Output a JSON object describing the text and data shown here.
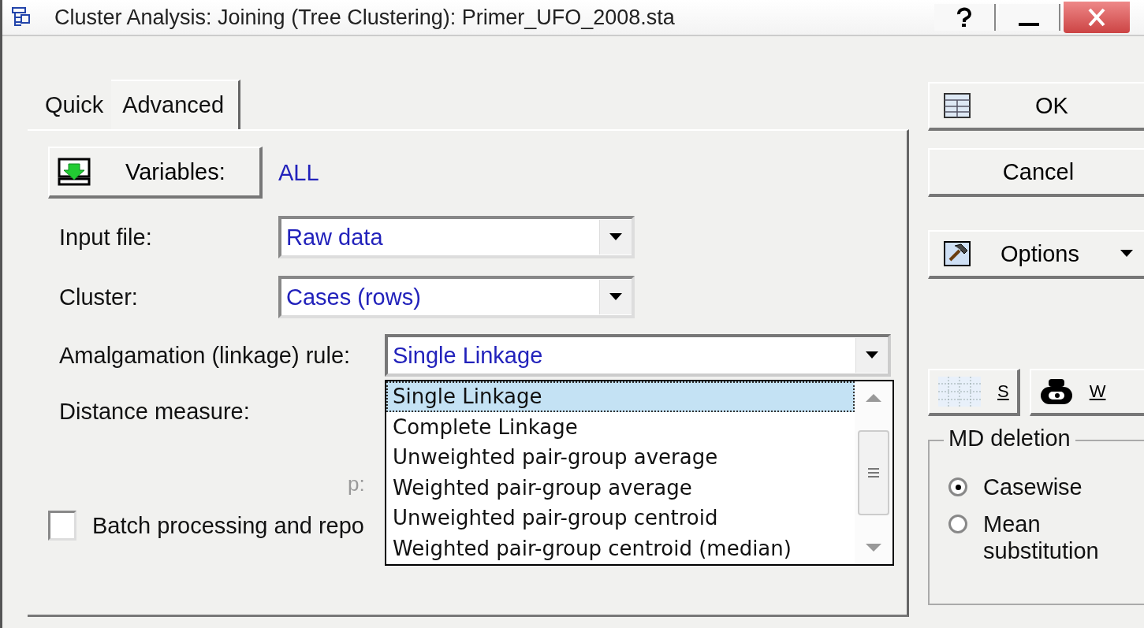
{
  "window": {
    "title": "Cluster Analysis: Joining (Tree Clustering): Primer_UFO_2008.sta"
  },
  "tabs": [
    {
      "label": "Quick",
      "selected": false
    },
    {
      "label": "Advanced",
      "selected": true
    }
  ],
  "variables": {
    "button": "Variables:",
    "value": "ALL"
  },
  "fields": [
    {
      "label": "Input file:",
      "value": "Raw data",
      "expanded": false
    },
    {
      "label": "Cluster:",
      "value": "Cases (rows)",
      "expanded": false
    },
    {
      "label": "Amalgamation (linkage) rule:",
      "value": "Single Linkage",
      "expanded": true
    }
  ],
  "dropdown_options": [
    {
      "label": "Single Linkage",
      "selected": true
    },
    {
      "label": "Complete Linkage",
      "selected": false
    },
    {
      "label": "Unweighted pair-group average",
      "selected": false
    },
    {
      "label": "Weighted pair-group average",
      "selected": false
    },
    {
      "label": "Unweighted pair-group centroid",
      "selected": false
    },
    {
      "label": "Weighted pair-group centroid (median)",
      "selected": false
    }
  ],
  "distance_label": "Distance measure:",
  "p_label": {
    "text": "p:",
    "disabled": true
  },
  "batch": {
    "label": "Batch processing and repo",
    "checked": false
  },
  "actions": [
    {
      "label": "OK",
      "kind": "ok"
    },
    {
      "label": "Cancel",
      "kind": "plain"
    },
    {
      "label": "Options",
      "kind": "menu"
    }
  ],
  "small_buttons": [
    {
      "label": "S",
      "kind": "spreadsheet"
    },
    {
      "label": "W",
      "kind": "weights"
    }
  ],
  "md_deletion": {
    "title": "MD deletion",
    "options": [
      {
        "label": "Casewise",
        "selected": true
      },
      {
        "label": "Mean substitution",
        "selected": false
      }
    ]
  }
}
